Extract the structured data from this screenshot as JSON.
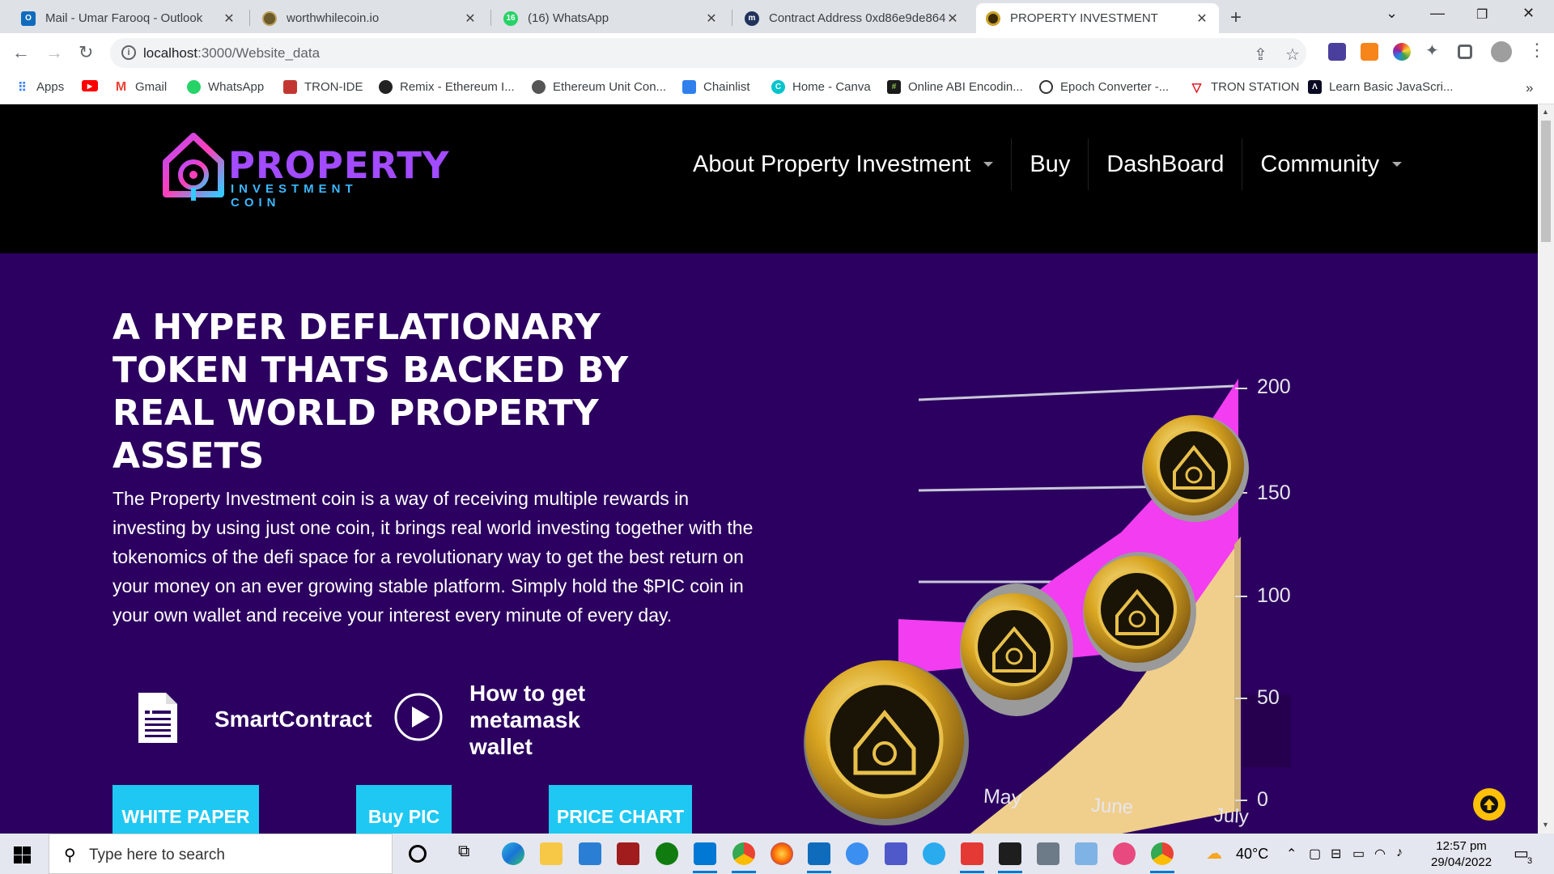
{
  "browser": {
    "tabs": [
      {
        "title": "Mail - Umar Farooq - Outlook",
        "icon": "outlook-icon",
        "color": "#0f6cbd",
        "active": false
      },
      {
        "title": "worthwhilecoin.io",
        "icon": "coin-icon",
        "color": "#6b5b2a",
        "active": false
      },
      {
        "title": "(16) WhatsApp",
        "icon": "whatsapp-icon",
        "color": "#25d366",
        "active": false
      },
      {
        "title": "Contract Address 0xd86e9de864",
        "icon": "etherscan-icon",
        "color": "#21325b",
        "active": false
      },
      {
        "title": "PROPERTY INVESTMENT",
        "icon": "property-coin-icon",
        "color": "#8a6d1c",
        "active": true
      }
    ],
    "whatsapp_badge": "16",
    "url_host": "localhost",
    "url_path": ":3000/Website_data",
    "bookmarks": [
      {
        "label": "Apps",
        "icon": "apps-grid-icon",
        "color": "#4285f4"
      },
      {
        "label": "",
        "icon": "youtube-icon",
        "color": "#ff0000"
      },
      {
        "label": "Gmail",
        "icon": "gmail-icon",
        "color": "#ea4335"
      },
      {
        "label": "WhatsApp",
        "icon": "whatsapp-icon",
        "color": "#25d366"
      },
      {
        "label": "TRON-IDE",
        "icon": "tron-ide-icon",
        "color": "#c23631"
      },
      {
        "label": "Remix - Ethereum I...",
        "icon": "remix-icon",
        "color": "#222222"
      },
      {
        "label": "Ethereum Unit Con...",
        "icon": "globe-icon",
        "color": "#555555"
      },
      {
        "label": "Chainlist",
        "icon": "chainlist-icon",
        "color": "#2f80ed"
      },
      {
        "label": "Home - Canva",
        "icon": "canva-icon",
        "color": "#00c4cc"
      },
      {
        "label": "Online ABI Encodin...",
        "icon": "hash-icon",
        "color": "#1a1a1a"
      },
      {
        "label": "Epoch Converter -...",
        "icon": "clock-icon",
        "color": "#333333"
      },
      {
        "label": "TRON STATION",
        "icon": "tron-icon",
        "color": "#e50915"
      },
      {
        "label": "Learn Basic JavaScri...",
        "icon": "learn-icon",
        "color": "#0a0a23"
      }
    ],
    "more_bookmarks": "»"
  },
  "site": {
    "logo_line1": "PROPERTY",
    "logo_line2": "INVESTMENT COIN",
    "nav": [
      {
        "label": "About Property Investment",
        "dropdown": true
      },
      {
        "label": "Buy",
        "dropdown": false
      },
      {
        "label": "DashBoard",
        "dropdown": false
      },
      {
        "label": "Community",
        "dropdown": true
      }
    ],
    "hero_title": "A HYPER DEFLATIONARY TOKEN THATS BACKED BY REAL WORLD PROPERTY ASSETS",
    "hero_text": "The Property Investment coin is a way of receiving multiple rewards in investing by using just one coin, it brings real world investing together with the tokenomics of the defi space for a revolutionary way to get the best return on your money on an ever growing stable platform. Simply hold the $PIC coin in your own wallet and receive your interest every minute of every day.",
    "smartcontract_label": "SmartContract",
    "metamask_label": "How to get metamask wallet",
    "buttons": [
      "WHITE PAPER",
      "Buy PIC",
      "PRICE CHART"
    ],
    "accent_color": "#1ec8f2",
    "hero_bg": "#2c0060",
    "chart_y_ticks": [
      "200",
      "150",
      "100",
      "50",
      "0"
    ],
    "chart_x_ticks": [
      "May",
      "June",
      "July"
    ]
  },
  "taskbar": {
    "search_placeholder": "Type here to search",
    "weather": "40°C",
    "time": "12:57 pm",
    "date": "29/04/2022",
    "notification_count": "3"
  }
}
